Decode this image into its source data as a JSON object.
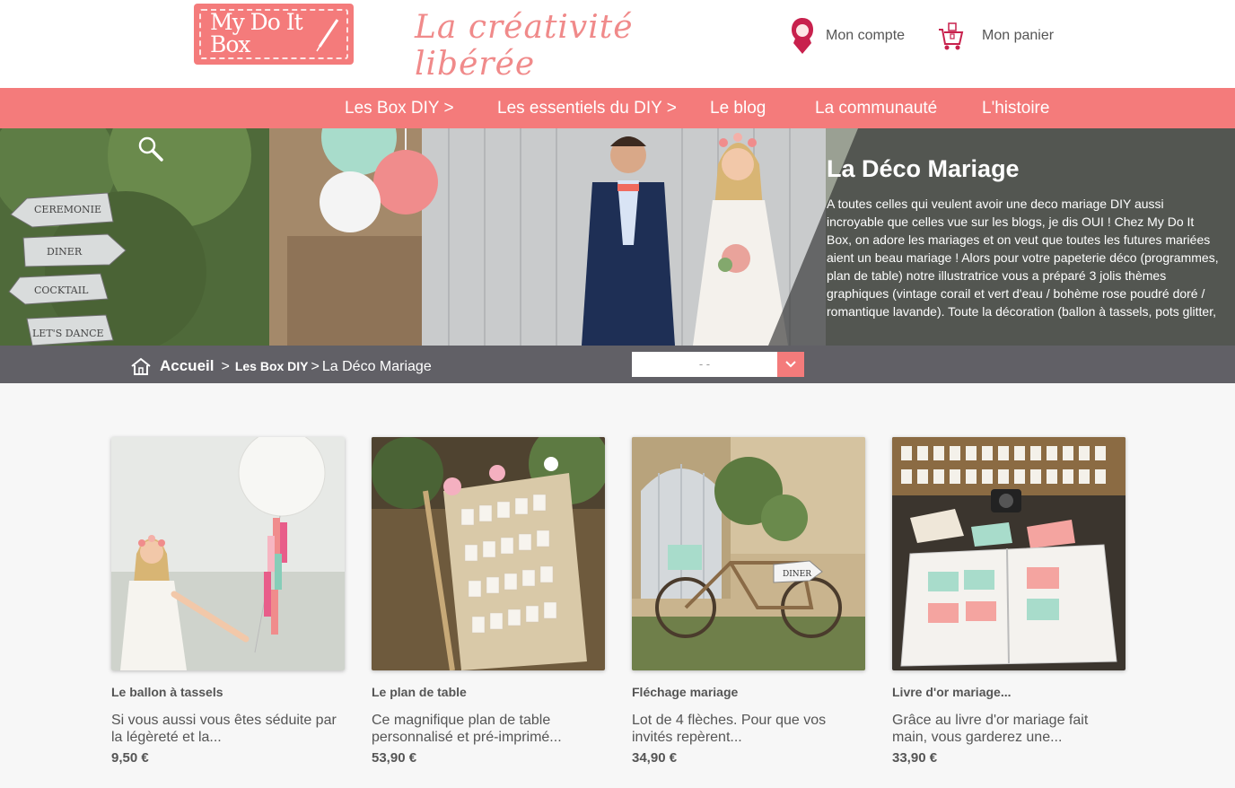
{
  "header": {
    "logo_text": "My Do It Box",
    "tagline": "La créativité libérée",
    "account_label": "Mon compte",
    "cart_label": "Mon panier"
  },
  "nav": {
    "items": [
      {
        "label": "Les Box DIY >"
      },
      {
        "label": "Les essentiels du DIY >"
      },
      {
        "label": "Le blog"
      },
      {
        "label": "La communauté"
      },
      {
        "label": "L'histoire"
      }
    ]
  },
  "hero": {
    "title": "La Déco Mariage",
    "description": "A toutes celles qui veulent avoir une deco mariage DIY aussi incroyable que celles vue sur les blogs, je dis OUI ! Chez My Do It Box, on adore les mariages et on veut que toutes les futures mariées aient un beau mariage ! Alors pour votre papeterie déco (programmes, plan de table) notre illustratrice vous a préparé 3 jolis thèmes graphiques (vintage corail et vert d'eau / bohème rose poudré doré / romantique lavande). Toute la décoration (ballon à tassels, pots glitter, fanions, decoration de",
    "signs": [
      "CEREMONIE",
      "DINER",
      "COCKTAIL",
      "LET'S DANCE"
    ]
  },
  "breadcrumb": {
    "home": "Accueil",
    "separator": ">",
    "category": "Les Box DIY",
    "current": "La Déco Mariage"
  },
  "sort": {
    "selected": "- -"
  },
  "products": [
    {
      "name": "Le ballon à tassels",
      "desc": "Si vous aussi vous êtes séduite par la légèreté et la...",
      "price": "9,50 €"
    },
    {
      "name": "Le plan de table",
      "desc": "Ce magnifique plan de table personnalisé et pré-imprimé...",
      "price": "53,90 €"
    },
    {
      "name": "Fléchage mariage",
      "desc": "Lot de 4 flèches. Pour que vos invités repèrent...",
      "price": "34,90 €",
      "sign_text": "DINER"
    },
    {
      "name": "Livre d'or mariage...",
      "desc": "Grâce au livre d'or mariage fait main, vous garderez une...",
      "price": "33,90 €"
    }
  ],
  "colors": {
    "brand": "#f47b7b",
    "bar": "#616066",
    "text": "#555555"
  }
}
